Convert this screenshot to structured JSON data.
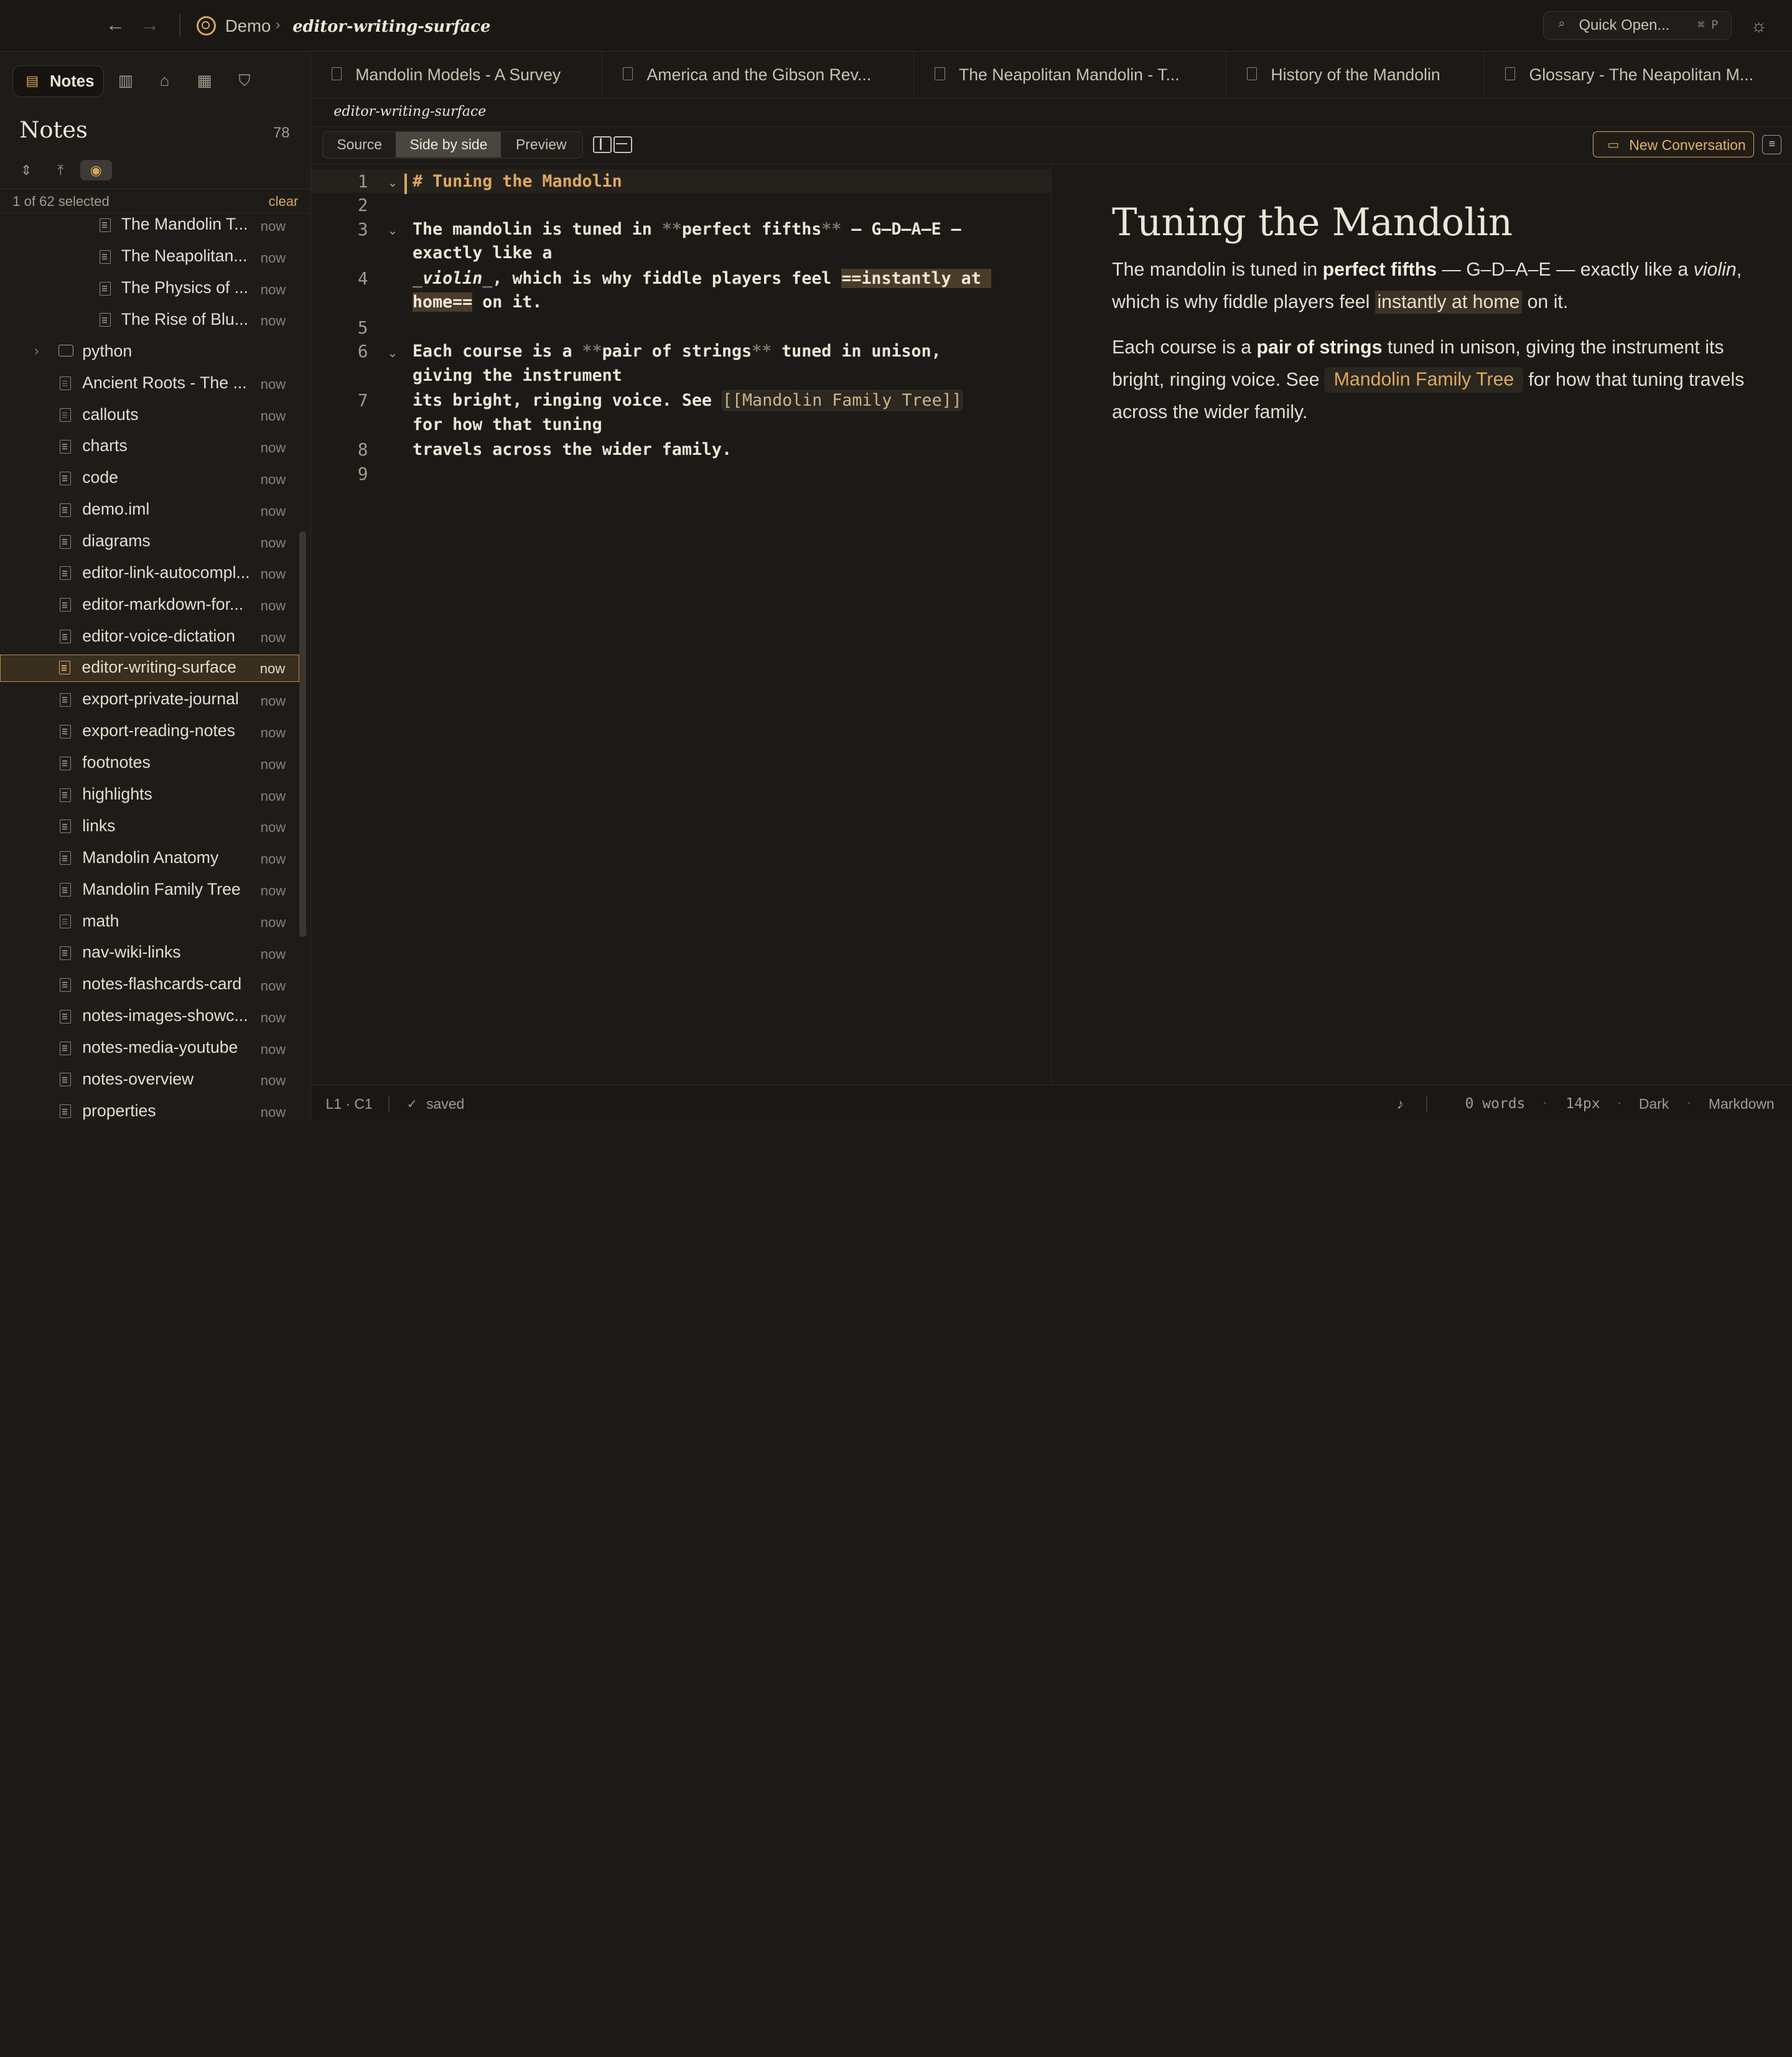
{
  "topbar": {
    "back_icon": "arrow-left-icon",
    "forward_icon": "arrow-right-icon",
    "breadcrumb_root": "Demo",
    "breadcrumb_sep": "›",
    "breadcrumb_current": "editor-writing-surface",
    "quick_open_label": "Quick Open...",
    "quick_open_kbd": "⌘ P",
    "theme_icon": "sun-icon"
  },
  "sidebar": {
    "active_tab": "Notes",
    "tool_icons": [
      "panel-icon",
      "tag-icon",
      "table-icon",
      "bookmark-icon"
    ],
    "heading": "Notes",
    "count": "78",
    "selection_text": "1 of 62 selected",
    "clear_label": "clear",
    "items": [
      {
        "name": "The Mandolin T...",
        "time": "now"
      },
      {
        "name": "The Neapolitan...",
        "time": "now"
      },
      {
        "name": "The Physics of ...",
        "time": "now"
      },
      {
        "name": "The Rise of Blu...",
        "time": "now"
      },
      {
        "name": "python",
        "time": ""
      },
      {
        "name": "Ancient Roots - The ...",
        "time": "now"
      },
      {
        "name": "callouts",
        "time": "now"
      },
      {
        "name": "charts",
        "time": "now"
      },
      {
        "name": "code",
        "time": "now"
      },
      {
        "name": "demo.iml",
        "time": "now"
      },
      {
        "name": "diagrams",
        "time": "now"
      },
      {
        "name": "editor-link-autocompl...",
        "time": "now"
      },
      {
        "name": "editor-markdown-for...",
        "time": "now"
      },
      {
        "name": "editor-voice-dictation",
        "time": "now"
      },
      {
        "name": "editor-writing-surface",
        "time": "now"
      },
      {
        "name": "export-private-journal",
        "time": "now"
      },
      {
        "name": "export-reading-notes",
        "time": "now"
      },
      {
        "name": "footnotes",
        "time": "now"
      },
      {
        "name": "highlights",
        "time": "now"
      },
      {
        "name": "links",
        "time": "now"
      },
      {
        "name": "Mandolin Anatomy",
        "time": "now"
      },
      {
        "name": "Mandolin Family Tree",
        "time": "now"
      },
      {
        "name": "math",
        "time": "now"
      },
      {
        "name": "nav-wiki-links",
        "time": "now"
      },
      {
        "name": "notes-flashcards-card",
        "time": "now"
      },
      {
        "name": "notes-images-showc...",
        "time": "now"
      },
      {
        "name": "notes-media-youtube",
        "time": "now"
      },
      {
        "name": "notes-overview",
        "time": "now"
      },
      {
        "name": "properties",
        "time": "now"
      }
    ]
  },
  "tabs": [
    "Mandolin Models - A Survey",
    "America and the Gibson Rev...",
    "The Neapolitan Mandolin - T...",
    "History of the Mandolin",
    "Glossary - The Neapolitan M..."
  ],
  "path_label": "editor-writing-surface",
  "modes": {
    "source": "Source",
    "side_by_side": "Side by side",
    "preview": "Preview",
    "active": "Side by side",
    "new_conversation": "New Conversation"
  },
  "editor": {
    "lines": [
      {
        "n": "1",
        "text": "# Tuning the Mandolin"
      },
      {
        "n": "2",
        "text": ""
      },
      {
        "n": "3",
        "text": "The mandolin is tuned in **perfect fifths** — G–D–A–E — exactly like a"
      },
      {
        "n": "4",
        "text": "_violin_, which is why fiddle players feel ==instantly at home== on it."
      },
      {
        "n": "5",
        "text": ""
      },
      {
        "n": "6",
        "text": "Each course is a **pair of strings** tuned in unison, giving the instrument"
      },
      {
        "n": "7",
        "text": "its bright, ringing voice. See [[Mandolin Family Tree]] for how that tuning"
      },
      {
        "n": "8",
        "text": "travels across the wider family."
      },
      {
        "n": "9",
        "text": ""
      }
    ],
    "seg": {
      "l1_hash": "# ",
      "l1_heading": "Tuning the Mandolin",
      "l3a": "The mandolin is tuned in ",
      "l3_mark_open": "**",
      "l3_bold": "perfect fifths",
      "l3_mark_close": "**",
      "l3b": " — G–D–A–E —",
      "l3c": "exactly like a",
      "l4_mark_open": "_",
      "l4_ital": "violin",
      "l4_mark_close": "_",
      "l4b": ", which is why fiddle players feel ",
      "l4_hl1": "==instantly at ",
      "l4_hl2": "home==",
      "l4c": " on it.",
      "l6a": "Each course is a ",
      "l6_mark_open": "**",
      "l6_bold": "pair of strings",
      "l6_mark_close": "**",
      "l6b": " tuned in unison,",
      "l6c": "giving the instrument",
      "l7a": "its bright, ringing voice. See ",
      "l7_link": "[[Mandolin Family Tree]]",
      "l7b": "for how that tuning",
      "l8": "travels across the wider family."
    }
  },
  "preview": {
    "title": "Tuning the Mandolin",
    "p1_a": "The mandolin is tuned in ",
    "p1_bold": "perfect fifths",
    "p1_b": " — G–D–A–E — exactly like a ",
    "p1_ital": "violin",
    "p1_c": ", which is why fiddle players feel ",
    "p1_mark": "instantly at home",
    "p1_d": " on it.",
    "p2_a": "Each course is a ",
    "p2_bold": "pair of strings",
    "p2_b": " tuned in unison, giving the instrument its bright, ringing voice. See ",
    "p2_link": "Mandolin Family Tree",
    "p2_c": " for how that tuning travels across the wider family."
  },
  "status": {
    "position": "L1 · C1",
    "saved": "saved",
    "mic_icon": "microphone-icon",
    "words": "0 words",
    "font_size": "14px",
    "theme": "Dark",
    "mode": "Markdown"
  },
  "colors": {
    "accent": "#d9a55a",
    "background": "#1c1a17",
    "text": "#e4ddd0"
  }
}
